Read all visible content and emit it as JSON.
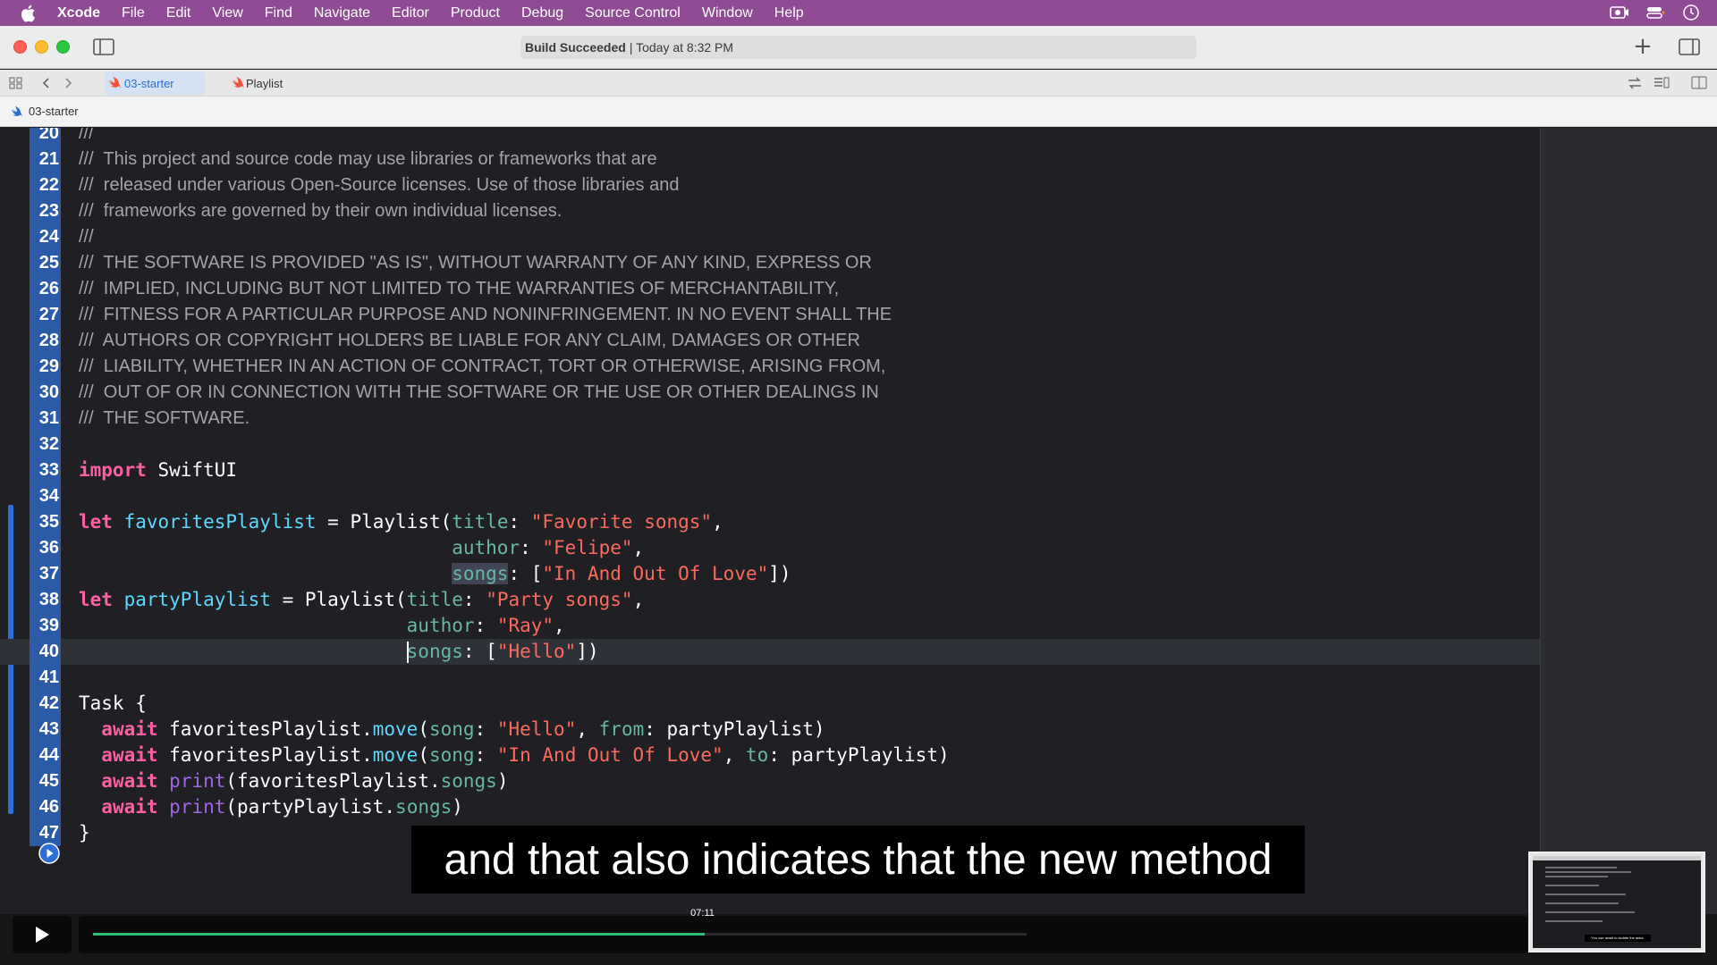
{
  "menubar": {
    "app_name": "Xcode",
    "items": [
      "File",
      "Edit",
      "View",
      "Find",
      "Navigate",
      "Editor",
      "Product",
      "Debug",
      "Source Control",
      "Window",
      "Help"
    ]
  },
  "toolbar": {
    "status_bold": "Build Succeeded",
    "status_rest": "| Today at 8:32 PM"
  },
  "tabs": [
    {
      "label": "03-starter",
      "icon": "swift-icon",
      "active": true
    },
    {
      "label": "Playlist",
      "icon": "swift-icon",
      "active": false
    }
  ],
  "breadcrumb": {
    "label": "03-starter"
  },
  "editor": {
    "current_line": 40,
    "lines": [
      {
        "n": "20",
        "c": "///"
      },
      {
        "n": "21",
        "c": "///  This project and source code may use libraries or frameworks that are"
      },
      {
        "n": "22",
        "c": "///  released under various Open-Source licenses. Use of those libraries and"
      },
      {
        "n": "23",
        "c": "///  frameworks are governed by their own individual licenses."
      },
      {
        "n": "24",
        "c": "///"
      },
      {
        "n": "25",
        "c": "///  THE SOFTWARE IS PROVIDED \"AS IS\", WITHOUT WARRANTY OF ANY KIND, EXPRESS OR"
      },
      {
        "n": "26",
        "c": "///  IMPLIED, INCLUDING BUT NOT LIMITED TO THE WARRANTIES OF MERCHANTABILITY,"
      },
      {
        "n": "27",
        "c": "///  FITNESS FOR A PARTICULAR PURPOSE AND NONINFRINGEMENT. IN NO EVENT SHALL THE"
      },
      {
        "n": "28",
        "c": "///  AUTHORS OR COPYRIGHT HOLDERS BE LIABLE FOR ANY CLAIM, DAMAGES OR OTHER"
      },
      {
        "n": "29",
        "c": "///  LIABILITY, WHETHER IN AN ACTION OF CONTRACT, TORT OR OTHERWISE, ARISING FROM,"
      },
      {
        "n": "30",
        "c": "///  OUT OF OR IN CONNECTION WITH THE SOFTWARE OR THE USE OR OTHER DEALINGS IN"
      },
      {
        "n": "31",
        "c": "///  THE SOFTWARE."
      },
      {
        "n": "32",
        "c": ""
      },
      {
        "n": "33",
        "c": "import SwiftUI"
      },
      {
        "n": "34",
        "c": ""
      },
      {
        "n": "35",
        "c": "let favoritesPlaylist = Playlist(title: \"Favorite songs\","
      },
      {
        "n": "36",
        "c": "                                 author: \"Felipe\","
      },
      {
        "n": "37",
        "c": "                                 songs: [\"In And Out Of Love\"])"
      },
      {
        "n": "38",
        "c": "let partyPlaylist = Playlist(title: \"Party songs\","
      },
      {
        "n": "39",
        "c": "                             author: \"Ray\","
      },
      {
        "n": "40",
        "c": "                             songs: [\"Hello\"])"
      },
      {
        "n": "41",
        "c": ""
      },
      {
        "n": "42",
        "c": "Task {"
      },
      {
        "n": "43",
        "c": "  await favoritesPlaylist.move(song: \"Hello\", from: partyPlaylist)"
      },
      {
        "n": "44",
        "c": "  await favoritesPlaylist.move(song: \"In And Out Of Love\", to: partyPlaylist)"
      },
      {
        "n": "45",
        "c": "  await print(favoritesPlaylist.songs)"
      },
      {
        "n": "46",
        "c": "  await print(partyPlaylist.songs)"
      },
      {
        "n": "47",
        "c": "}"
      }
    ]
  },
  "caption": "and that also indicates that the new method",
  "video": {
    "time_label": "07:11",
    "progress_fraction": 0.655
  },
  "thumbnail": {
    "caption": "You use await to isolate the actor."
  },
  "colors": {
    "menubar": "#8f4b94",
    "editor_bg": "#1f1f24",
    "keyword": "#fc5fa3",
    "string": "#fc6a5d",
    "progress": "#2dbd74",
    "gutter_highlight": "#2b5aa6"
  }
}
